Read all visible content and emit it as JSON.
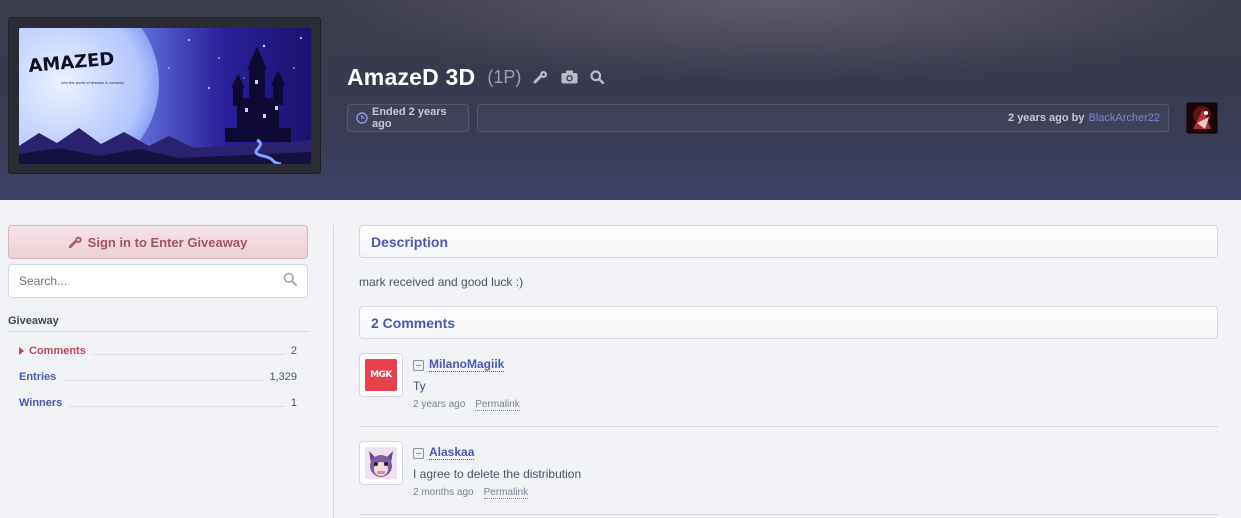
{
  "banner": {
    "logo_text": "AMAZED",
    "tagline": "into the world of dreams & curiosity"
  },
  "giveaway": {
    "title": "AmazeD 3D",
    "points": "(1P)",
    "status": "Ended 2 years ago",
    "created": "2 years ago by",
    "creator": "BlackArcher22"
  },
  "icons": {
    "steam": "steam-icon",
    "screenshots": "camera-icon",
    "search": "search-icon",
    "clock": "clock-icon",
    "key": "key-icon"
  },
  "sidebar": {
    "signin_label": "Sign in to Enter Giveaway",
    "search_placeholder": "Search...",
    "heading": "Giveaway",
    "items": [
      {
        "label": "Comments",
        "count": "2"
      },
      {
        "label": "Entries",
        "count": "1,329"
      },
      {
        "label": "Winners",
        "count": "1"
      }
    ]
  },
  "description": {
    "heading": "Description",
    "text": "mark received and good luck :)"
  },
  "comments": {
    "heading": "2 Comments",
    "list": [
      {
        "user": "MilanoMagiik",
        "avatar_text": "MGK",
        "text": "Ty",
        "time": "2 years ago",
        "permalink": "Permalink"
      },
      {
        "user": "Alaskaa",
        "text": "I agree to delete the distribution",
        "time": "2 months ago",
        "permalink": "Permalink"
      }
    ]
  },
  "colors": {
    "accent": "#4b58b0",
    "active": "#b54a5f",
    "header_bg": "#3b3f5e"
  }
}
